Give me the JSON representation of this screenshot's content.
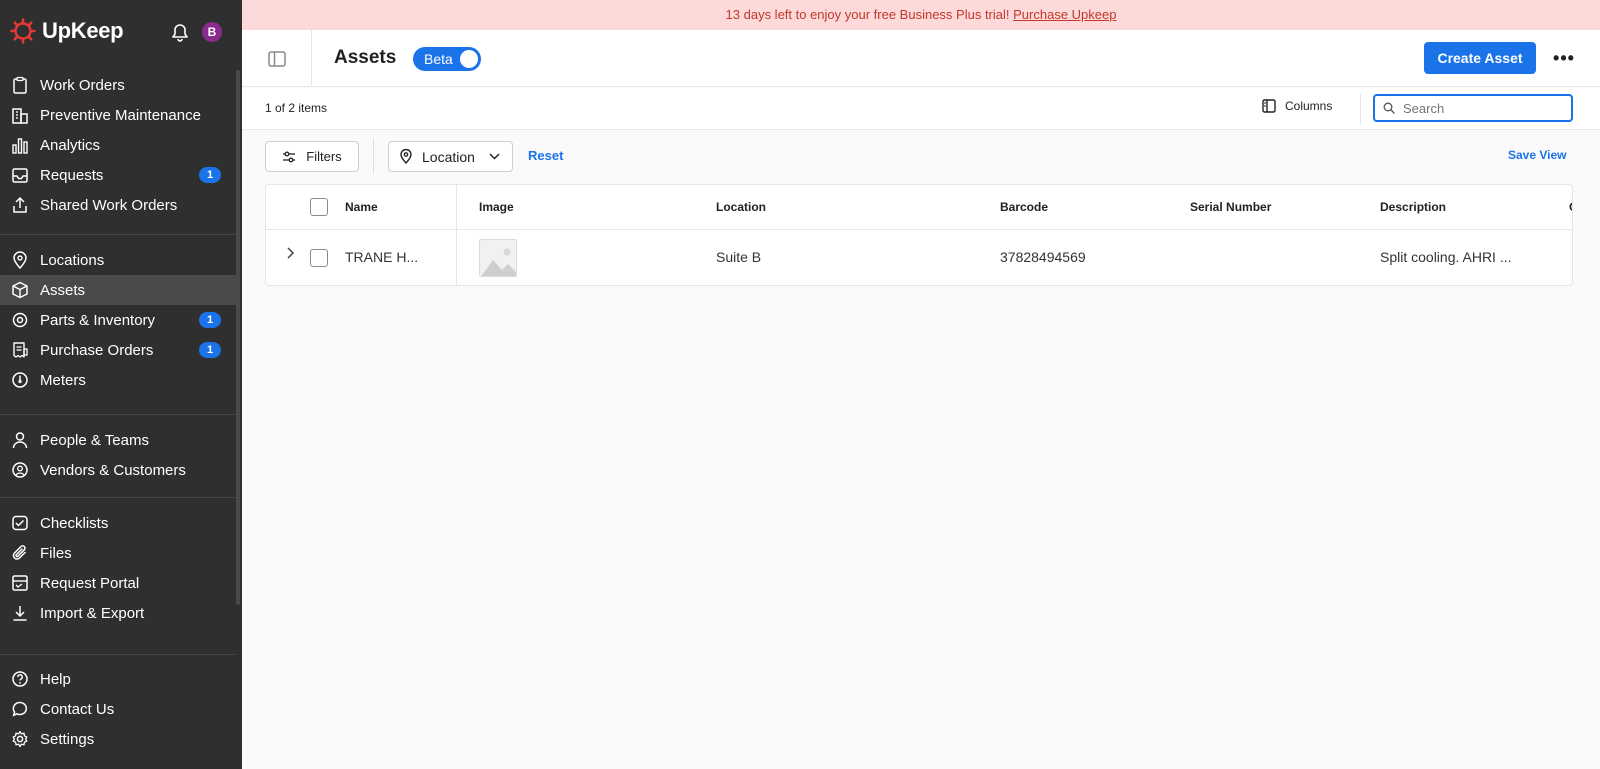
{
  "sidebar": {
    "brand": "UpKeep",
    "avatar_initial": "B",
    "groups": [
      [
        {
          "label": "Work Orders",
          "icon": "clipboard-icon"
        },
        {
          "label": "Preventive Maintenance",
          "icon": "building-icon"
        },
        {
          "label": "Analytics",
          "icon": "bar-chart-icon"
        },
        {
          "label": "Requests",
          "icon": "inbox-icon",
          "badge": "1"
        },
        {
          "label": "Shared Work Orders",
          "icon": "share-icon"
        }
      ],
      [
        {
          "label": "Locations",
          "icon": "map-pin-icon"
        },
        {
          "label": "Assets",
          "icon": "cube-icon",
          "active": true
        },
        {
          "label": "Parts & Inventory",
          "icon": "gear-part-icon",
          "badge": "1"
        },
        {
          "label": "Purchase Orders",
          "icon": "receipt-icon",
          "badge": "1"
        },
        {
          "label": "Meters",
          "icon": "gauge-icon"
        }
      ],
      [
        {
          "label": "People & Teams",
          "icon": "person-icon"
        },
        {
          "label": "Vendors & Customers",
          "icon": "vendor-icon"
        }
      ],
      [
        {
          "label": "Checklists",
          "icon": "checklist-icon"
        },
        {
          "label": "Files",
          "icon": "paperclip-icon"
        },
        {
          "label": "Request Portal",
          "icon": "portal-icon"
        },
        {
          "label": "Import & Export",
          "icon": "download-icon"
        }
      ],
      [
        {
          "label": "Help",
          "icon": "help-icon"
        },
        {
          "label": "Contact Us",
          "icon": "chat-icon"
        },
        {
          "label": "Settings",
          "icon": "settings-icon"
        }
      ]
    ]
  },
  "banner": {
    "text": "13 days left to enjoy your free Business Plus trial! ",
    "link": "Purchase Upkeep"
  },
  "header": {
    "title": "Assets",
    "beta_label": "Beta",
    "beta_enabled": true,
    "create_label": "Create Asset",
    "more_label": "•••"
  },
  "toolbar": {
    "item_count": "1 of 2 items",
    "columns_label": "Columns",
    "search_placeholder": "Search",
    "search_value": ""
  },
  "filters": {
    "filters_label": "Filters",
    "location_label": "Location",
    "reset_label": "Reset",
    "save_view_label": "Save View"
  },
  "table": {
    "columns": [
      "Name",
      "Image",
      "Location",
      "Barcode",
      "Serial Number",
      "Description",
      "C"
    ],
    "rows": [
      {
        "name": "TRANE H...",
        "image": "placeholder-image-icon",
        "location": "Suite B",
        "barcode": "37828494569",
        "serial_number": "",
        "description": "Split cooling. AHRI ..."
      }
    ]
  },
  "colors": {
    "accent": "#1a73e8",
    "sidebar_bg": "#2f2f2f",
    "banner_bg": "#fdd9d9",
    "banner_text": "#c0392b",
    "logo": "#e53935",
    "avatar": "#8a2c8f"
  }
}
